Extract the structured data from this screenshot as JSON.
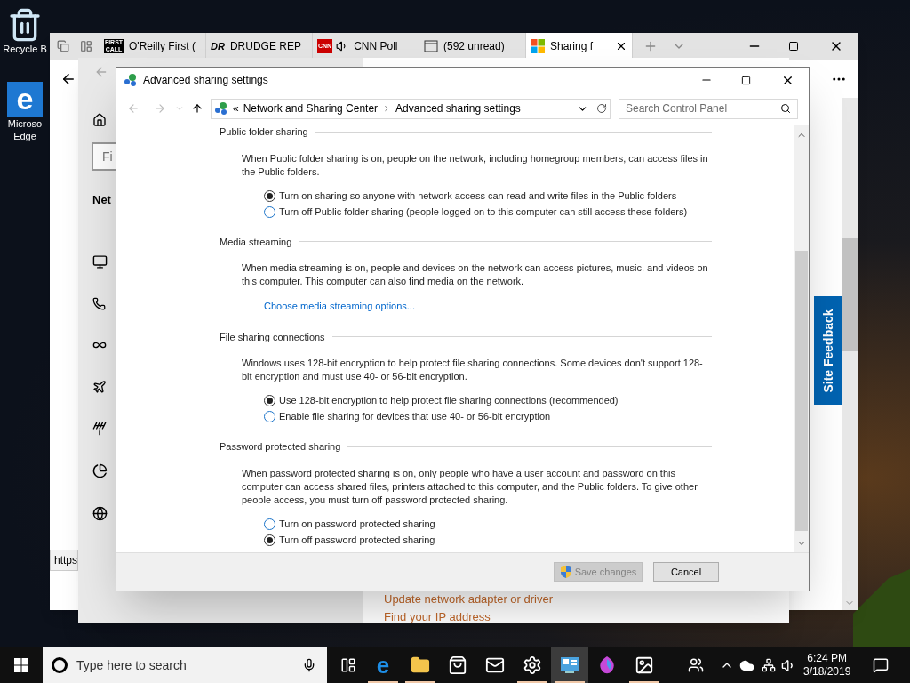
{
  "desktop_icons": [
    {
      "kind": "recycle",
      "label": "Recycle B"
    },
    {
      "kind": "edge",
      "glyph": "e",
      "label": "Microso Edge"
    }
  ],
  "browser": {
    "tabs": [
      {
        "kind": "firstcall",
        "logo": "FIRST CALL",
        "title": "O'Reilly First (",
        "selected": false
      },
      {
        "kind": "drudge",
        "logo": "DR",
        "title": "DRUDGE REP",
        "selected": false
      },
      {
        "kind": "cnn",
        "logo": "CNN",
        "title": "CNN Poll",
        "selected": false
      },
      {
        "kind": "mail",
        "title": "(592 unread)",
        "selected": false
      },
      {
        "kind": "microsoft",
        "title": "Sharing f",
        "selected": true
      }
    ],
    "status_url": "https",
    "site_feedback": "Site Feedback"
  },
  "settings_window": {
    "search_placeholder": "Fi",
    "heading": "Net",
    "links": [
      "Update network adapter or driver",
      "Find your IP address"
    ]
  },
  "dialog": {
    "title": "Advanced sharing settings",
    "breadcrumb_prefix": "«",
    "breadcrumb": [
      "Network and Sharing Center",
      "Advanced sharing settings"
    ],
    "search_placeholder": "Search Control Panel",
    "sections": [
      {
        "heading": "Public folder sharing",
        "description": "When Public folder sharing is on, people on the network, including homegroup members, can access files in the Public folders.",
        "items": [
          {
            "kind": "radio",
            "label": "Turn on sharing so anyone with network access can read and write files in the Public folders",
            "selected": true
          },
          {
            "kind": "radio",
            "label": "Turn off Public folder sharing (people logged on to this computer can still access these folders)",
            "selected": false
          }
        ]
      },
      {
        "heading": "Media streaming",
        "description": "When media streaming is on, people and devices on the network can access pictures, music, and videos on this computer. This computer can also find media on the network.",
        "items": [
          {
            "kind": "link",
            "label": "Choose media streaming options..."
          }
        ]
      },
      {
        "heading": "File sharing connections",
        "description": "Windows uses 128-bit encryption to help protect file sharing connections. Some devices don't support 128-bit encryption and must use 40- or 56-bit encryption.",
        "items": [
          {
            "kind": "radio",
            "label": "Use 128-bit encryption to help protect file sharing connections (recommended)",
            "selected": true
          },
          {
            "kind": "radio",
            "label": "Enable file sharing for devices that use 40- or 56-bit encryption",
            "selected": false
          }
        ]
      },
      {
        "heading": "Password protected sharing",
        "description": "When password protected sharing is on, only people who have a user account and password on this computer can access shared files, printers attached to this computer, and the Public folders. To give other people access, you must turn off password protected sharing.",
        "items": [
          {
            "kind": "radio",
            "label": "Turn on password protected sharing",
            "selected": false
          },
          {
            "kind": "radio",
            "label": "Turn off password protected sharing",
            "selected": true
          }
        ]
      }
    ],
    "buttons": [
      {
        "kind": "shield",
        "label": "Save changes",
        "disabled": true
      },
      {
        "kind": "plain",
        "label": "Cancel",
        "disabled": false
      }
    ]
  },
  "taskbar": {
    "search_placeholder": "Type here to search",
    "apps": [
      {
        "kind": "edge",
        "glyph": "e",
        "selected": false,
        "running": true
      },
      {
        "kind": "explorer",
        "selected": false,
        "running": true
      },
      {
        "kind": "store",
        "selected": false,
        "running": false
      },
      {
        "kind": "mail",
        "selected": false,
        "running": false
      },
      {
        "kind": "settings",
        "selected": false,
        "running": true
      },
      {
        "kind": "control",
        "selected": true,
        "running": true
      },
      {
        "kind": "paint",
        "selected": false,
        "running": false
      },
      {
        "kind": "photos",
        "selected": false,
        "running": true
      }
    ],
    "time": "6:24 PM",
    "date": "3/18/2019"
  }
}
